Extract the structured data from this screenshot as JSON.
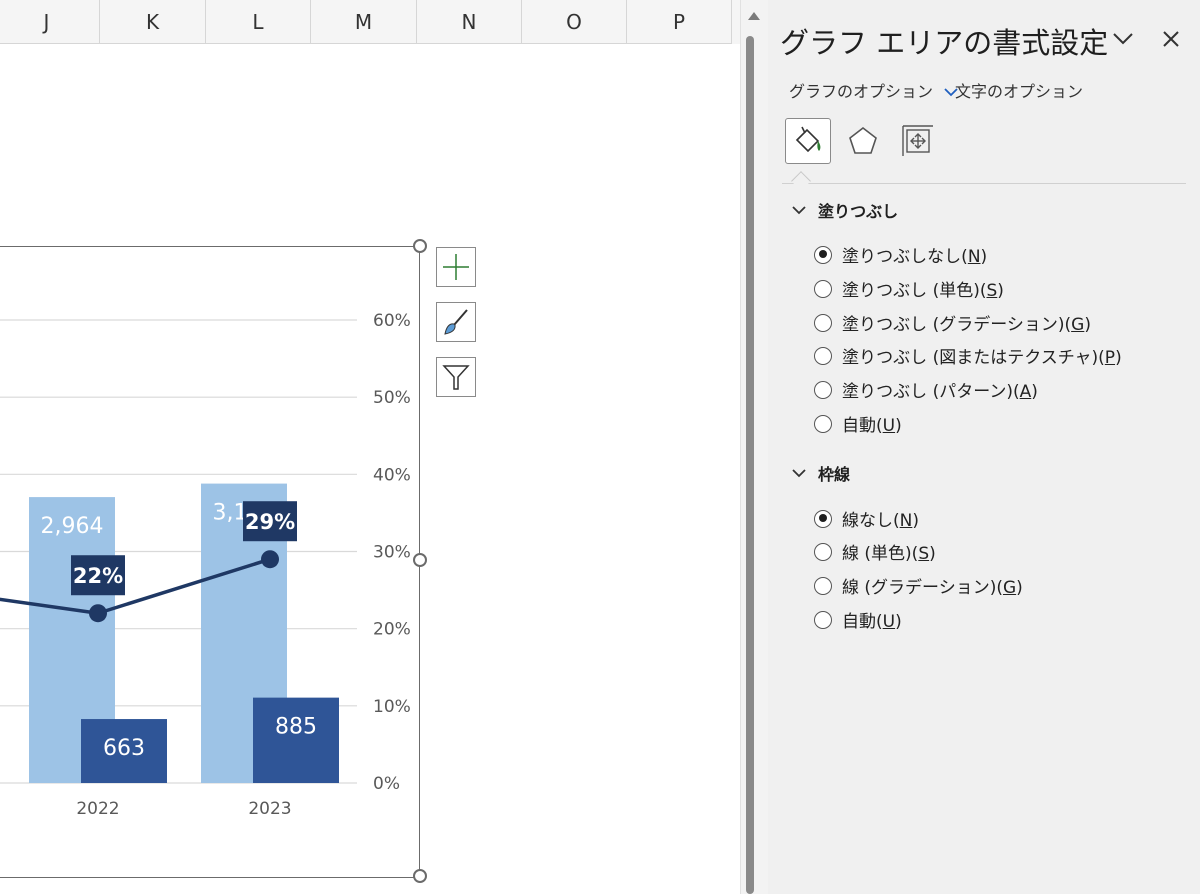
{
  "sheet": {
    "columns": [
      "J",
      "K",
      "L",
      "M",
      "N",
      "O",
      "P"
    ]
  },
  "chart_data": {
    "type": "bar",
    "categories": [
      "2022",
      "2023"
    ],
    "series": [
      {
        "values": [
          2964,
          3104
        ],
        "labels": [
          "2,964",
          "3,104"
        ],
        "color": "#9dc3e6"
      },
      {
        "values": [
          663,
          885
        ],
        "labels": [
          "663",
          "885"
        ],
        "color": "#2f5597"
      },
      {
        "type": "line",
        "values": [
          22,
          29
        ],
        "labels": [
          "22%",
          "29%"
        ],
        "color": "#1f3864",
        "axis": "secondary"
      }
    ],
    "secondary_axis": {
      "ticks": [
        "60%",
        "50%",
        "40%",
        "30%",
        "20%",
        "10%",
        "0%"
      ],
      "ylim": [
        0,
        60
      ],
      "unit": "%"
    },
    "primary_ylim": [
      0,
      4800
    ],
    "grid": true
  },
  "pane": {
    "title": "グラフ エリアの書式設定",
    "tabs": {
      "chart_options": "グラフのオプション",
      "text_options": "文字のオプション"
    },
    "fill": {
      "heading": "塗りつぶし",
      "options": [
        {
          "label": "塗りつぶしなし(",
          "key": "N",
          "close": ")"
        },
        {
          "label": "塗りつぶし (単色)(",
          "key": "S",
          "close": ")"
        },
        {
          "label": "塗りつぶし (グラデーション)(",
          "key": "G",
          "close": ")"
        },
        {
          "label": "塗りつぶし (図またはテクスチャ)(",
          "key": "P",
          "close": ")"
        },
        {
          "label": "塗りつぶし (パターン)(",
          "key": "A",
          "close": ")"
        },
        {
          "label": "自動(",
          "key": "U",
          "close": ")"
        }
      ]
    },
    "border": {
      "heading": "枠線",
      "options": [
        {
          "label": "線なし(",
          "key": "N",
          "close": ")"
        },
        {
          "label": "線 (単色)(",
          "key": "S",
          "close": ")"
        },
        {
          "label": "線 (グラデーション)(",
          "key": "G",
          "close": ")"
        },
        {
          "label": "自動(",
          "key": "U",
          "close": ")"
        }
      ]
    }
  }
}
